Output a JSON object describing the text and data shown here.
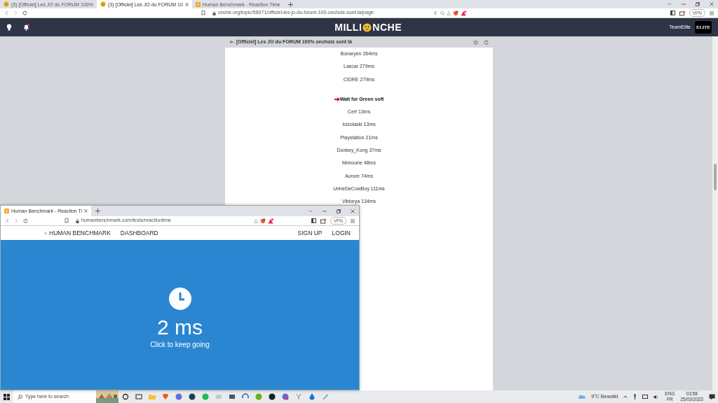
{
  "outer_browser": {
    "tabs": [
      {
        "title": "(3) [Officiel] Les JO du FORUM 100%",
        "selected": false
      },
      {
        "title": "(3) [Officiel] Les JO du FORUM 10",
        "selected": true
      },
      {
        "title": "Human Benchmark - Reaction Time",
        "selected": false
      }
    ],
    "url": "onche.org/topic/56071/officiel-les-jo-du-forum-100-onchois-sont-la/page:",
    "vpn_label": "VPN"
  },
  "site_header": {
    "logo_left": "MILLI",
    "logo_right": "NCHE",
    "username": "TeamElite",
    "avatar_text": "ELITE"
  },
  "topic": {
    "title": "[Officiel] Les JO du FORUM 100% onchois sont là"
  },
  "post_lines": [
    {
      "kind": "entry",
      "text": "Bonaryen 264ms"
    },
    {
      "kind": "entry",
      "text": "Lascar 279ms"
    },
    {
      "kind": "entry",
      "text": "CIDRE 279ms"
    },
    {
      "kind": "heading",
      "text": "Wait for Green soft"
    },
    {
      "kind": "entry",
      "text": "Cerf 13ms"
    },
    {
      "kind": "entry",
      "text": "Icizolaski 13ms"
    },
    {
      "kind": "entry",
      "text": "Playstation 21ms"
    },
    {
      "kind": "entry",
      "text": "Donkey_Kong 37ms"
    },
    {
      "kind": "entry",
      "text": "Mimoune 48ms"
    },
    {
      "kind": "entry",
      "text": "Aurore 74ms"
    },
    {
      "kind": "entry",
      "text": "UrineDeCowBoy 111ms"
    },
    {
      "kind": "entry",
      "text": "Viktorya 134ms"
    }
  ],
  "popup_browser": {
    "tab_title": "Human Benchmark - Reaction Ti",
    "url": "humanbenchmark.com/tests/reactiontime",
    "vpn_label": "VPN",
    "nav_left": [
      "HUMAN BENCHMARK",
      "DASHBOARD"
    ],
    "nav_right": [
      "SIGN UP",
      "LOGIN"
    ],
    "result": "2 ms",
    "prompt": "Click to keep going"
  },
  "taskbar": {
    "search_placeholder": "Type here to search",
    "weather": "9°C  Bewolkt",
    "language": "ENG",
    "layout": "FR",
    "time": "03:58",
    "date": "25/03/2023"
  }
}
